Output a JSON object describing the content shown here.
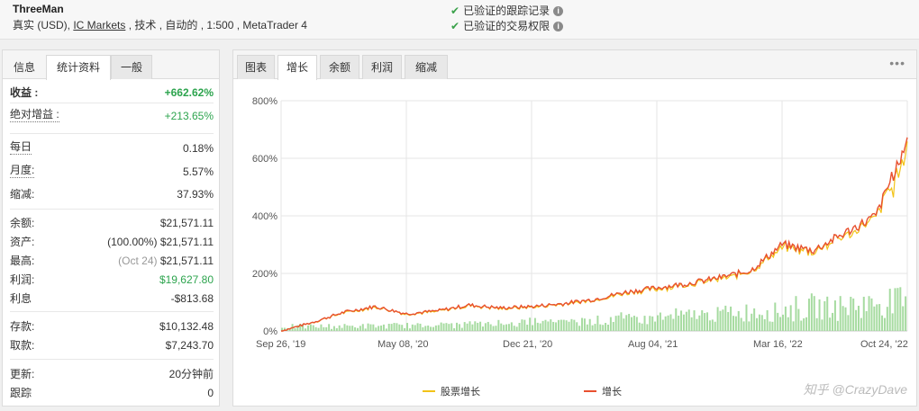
{
  "header": {
    "name": "ThreeMan",
    "meta_prefix": "真实 (USD), ",
    "broker": "IC Markets",
    "meta_suffix": " , 技术 , 自动的 , 1:500 , MetaTrader 4",
    "verify_track": "已验证的跟踪记录",
    "verify_privilege": "已验证的交易权限",
    "info_glyph": "i"
  },
  "left_tabs": [
    "信息",
    "统计资料",
    "一般"
  ],
  "stats": [
    {
      "label": "收益 :",
      "value": "+662.62%"
    },
    {
      "label": "绝对增益 :",
      "value": "+213.65%"
    },
    {
      "label": "每日",
      "value": "0.18%"
    },
    {
      "label": "月度:",
      "value": "5.57%"
    },
    {
      "label": "缩减:",
      "value": "37.93%"
    },
    {
      "label": "余额:",
      "value": "$21,571.11"
    },
    {
      "label": "资产:",
      "value_prefix": "(100.00%)",
      "value": "$21,571.11"
    },
    {
      "label": "最高:",
      "value_prefix": "(Oct 24)",
      "value": "$21,571.11"
    },
    {
      "label": "利润:",
      "value": "$19,627.80"
    },
    {
      "label": "利息",
      "value": "-$813.68"
    },
    {
      "label": "存款:",
      "value": "$10,132.48"
    },
    {
      "label": "取款:",
      "value": "$7,243.70"
    },
    {
      "label": "更新:",
      "value": "20分钟前"
    },
    {
      "label": "跟踪",
      "value": "0"
    }
  ],
  "right_tabs": [
    "图表",
    "增长",
    "余额",
    "利润",
    "缩减"
  ],
  "more_glyph": "•••",
  "watermark": "知乎 @CrazyDave",
  "colors": {
    "growth": "#e8502f",
    "equity": "#f2c318",
    "volume": "#a6dba0",
    "green_text": "#2da44e"
  },
  "chart_data": {
    "type": "line",
    "x_ticks": [
      "Sep 26, '19",
      "May 08, '20",
      "Dec 21, '20",
      "Aug 04, '21",
      "Mar 16, '22",
      "Oct 24, '22"
    ],
    "y_ticks": [
      "0%",
      "200%",
      "400%",
      "600%",
      "800%"
    ],
    "ylim": [
      0,
      800
    ],
    "legend_position": "bottom",
    "series": [
      {
        "name": "股票增长",
        "color": "#f2c318"
      },
      {
        "name": "增长",
        "color": "#e8502f",
        "x": [
          0,
          0.05,
          0.1,
          0.15,
          0.2,
          0.25,
          0.3,
          0.35,
          0.4,
          0.45,
          0.5,
          0.55,
          0.6,
          0.65,
          0.7,
          0.75,
          0.8,
          0.85,
          0.9,
          0.95,
          1
        ],
        "values": [
          0,
          30,
          65,
          85,
          60,
          70,
          90,
          80,
          85,
          95,
          110,
          135,
          150,
          165,
          185,
          210,
          300,
          280,
          340,
          400,
          662
        ]
      }
    ]
  }
}
